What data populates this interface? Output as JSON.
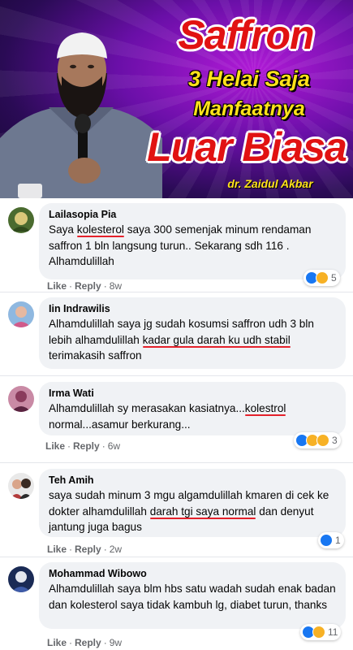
{
  "banner": {
    "title_line1": "Saffron",
    "title_line2": "3 Helai Saja",
    "title_line3": "Manfaatnya",
    "title_line4": "Luar Biasa",
    "author": "dr. Zaidul Akbar"
  },
  "actions": {
    "like": "Like",
    "reply": "Reply"
  },
  "comments": [
    {
      "author": "Lailasopia Pia",
      "text_parts": [
        "Saya ",
        "kolesterol",
        " saya 300 semenjak minum rendaman saffron 1 bln langsung turun.. Sekarang sdh 116 . Alhamdulillah"
      ],
      "time": "8w",
      "reaction_count": "5",
      "reactions": [
        "like-reaction-icon",
        "sad-reaction-icon"
      ]
    },
    {
      "author": "Iin Indrawilis",
      "text_parts": [
        "Alhamdulillah saya jg sudah kosumsi saffron udh 3 bln lebih alhamdulillah ",
        "kadar gula darah ku udh stabil",
        " terimakasih saffron"
      ]
    },
    {
      "author": "Irma Wati",
      "text_parts": [
        "Alhamdulillah sy merasakan kasiatnya...",
        "kolestrol",
        " normal...asamur berkurang..."
      ],
      "time": "6w",
      "reaction_count": "3",
      "reactions": [
        "like-reaction-icon",
        "sad-reaction-icon",
        "laugh-reaction-icon"
      ]
    },
    {
      "author": "Teh Amih",
      "text_parts": [
        "saya sudah minum 3 mgu algamdulillah kmaren di cek ke dokter alhamdulillah ",
        "darah tgi saya normal",
        " dan ",
        "denyut jantung juga bagus"
      ],
      "time": "2w",
      "reaction_count": "1",
      "reactions": [
        "like-reaction-icon"
      ]
    },
    {
      "author": "Mohammad Wibowo",
      "text_parts": [
        "Alhamdulillah saya blm hbs satu wadah sudah enak ",
        "badan dan kolesterol saya tidak kambuh lg",
        ", diabet turun, thanks"
      ],
      "time": "9w",
      "reaction_count": "11",
      "reactions": [
        "like-reaction-icon",
        "sad-reaction-icon"
      ]
    }
  ],
  "colors": {
    "highlight": "#e4212b",
    "bubble": "#f0f2f5",
    "meta": "#65676b",
    "like_blue": "#1877f2",
    "emoji_yellow": "#f7b125"
  }
}
